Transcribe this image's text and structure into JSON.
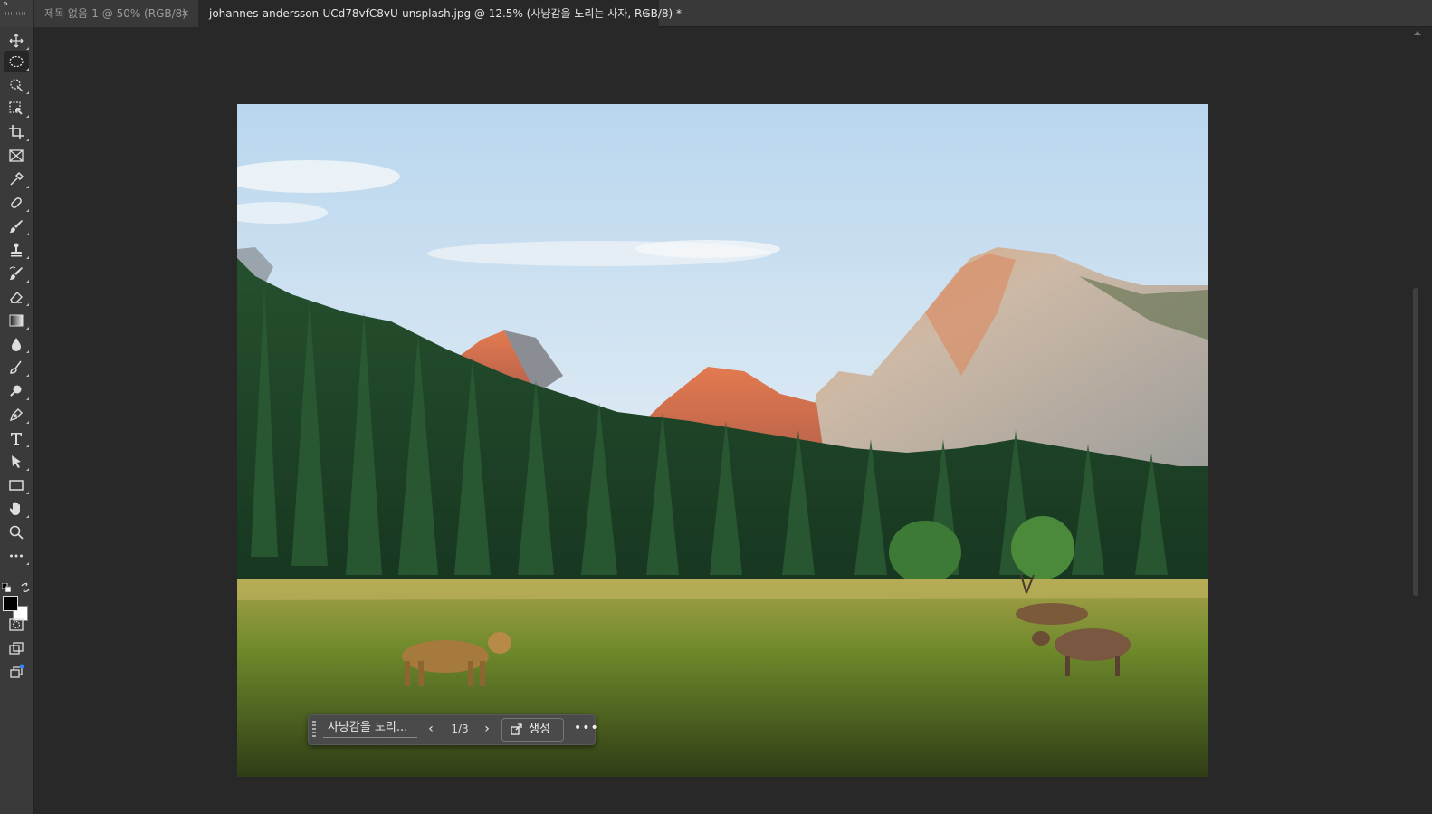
{
  "tabs": [
    {
      "label": "제목 없음-1 @ 50% (RGB/8)",
      "close": "×"
    },
    {
      "label": "johannes-andersson-UCd78vfC8vU-unsplash.jpg @ 12.5% (사냥감을 노리는 사자, RGB/8) *",
      "close": "×"
    }
  ],
  "toolbar": {
    "tools": [
      "move-tool-icon",
      "elliptical-marquee-tool-icon",
      "quick-selection-tool-icon",
      "object-selection-tool-icon",
      "crop-tool-icon",
      "frame-tool-icon",
      "eyedropper-tool-icon",
      "spot-healing-brush-icon",
      "brush-tool-icon",
      "clone-stamp-tool-icon",
      "history-brush-icon",
      "eraser-tool-icon",
      "gradient-tool-icon",
      "blur-tool-icon",
      "smudge-tool-icon",
      "dodge-tool-icon",
      "pen-tool-icon",
      "type-tool-icon",
      "path-selection-tool-icon",
      "rectangle-tool-icon",
      "hand-tool-icon",
      "zoom-tool-icon",
      "more-tools-icon"
    ],
    "foreground_color": "#000000",
    "background_color": "#ffffff"
  },
  "taskbar": {
    "prompt": "사냥감을 노리...",
    "counter": "1/3",
    "prev": "‹",
    "next": "›",
    "generate_label": "생성",
    "more": "•••"
  },
  "colors": {
    "app_bg": "#282828",
    "panel_bg": "#3a3a3a",
    "tab_active": "#282828",
    "sky": "#d9e8f3",
    "forest": "#1f4a2a",
    "meadow": "#7a8a2a"
  }
}
